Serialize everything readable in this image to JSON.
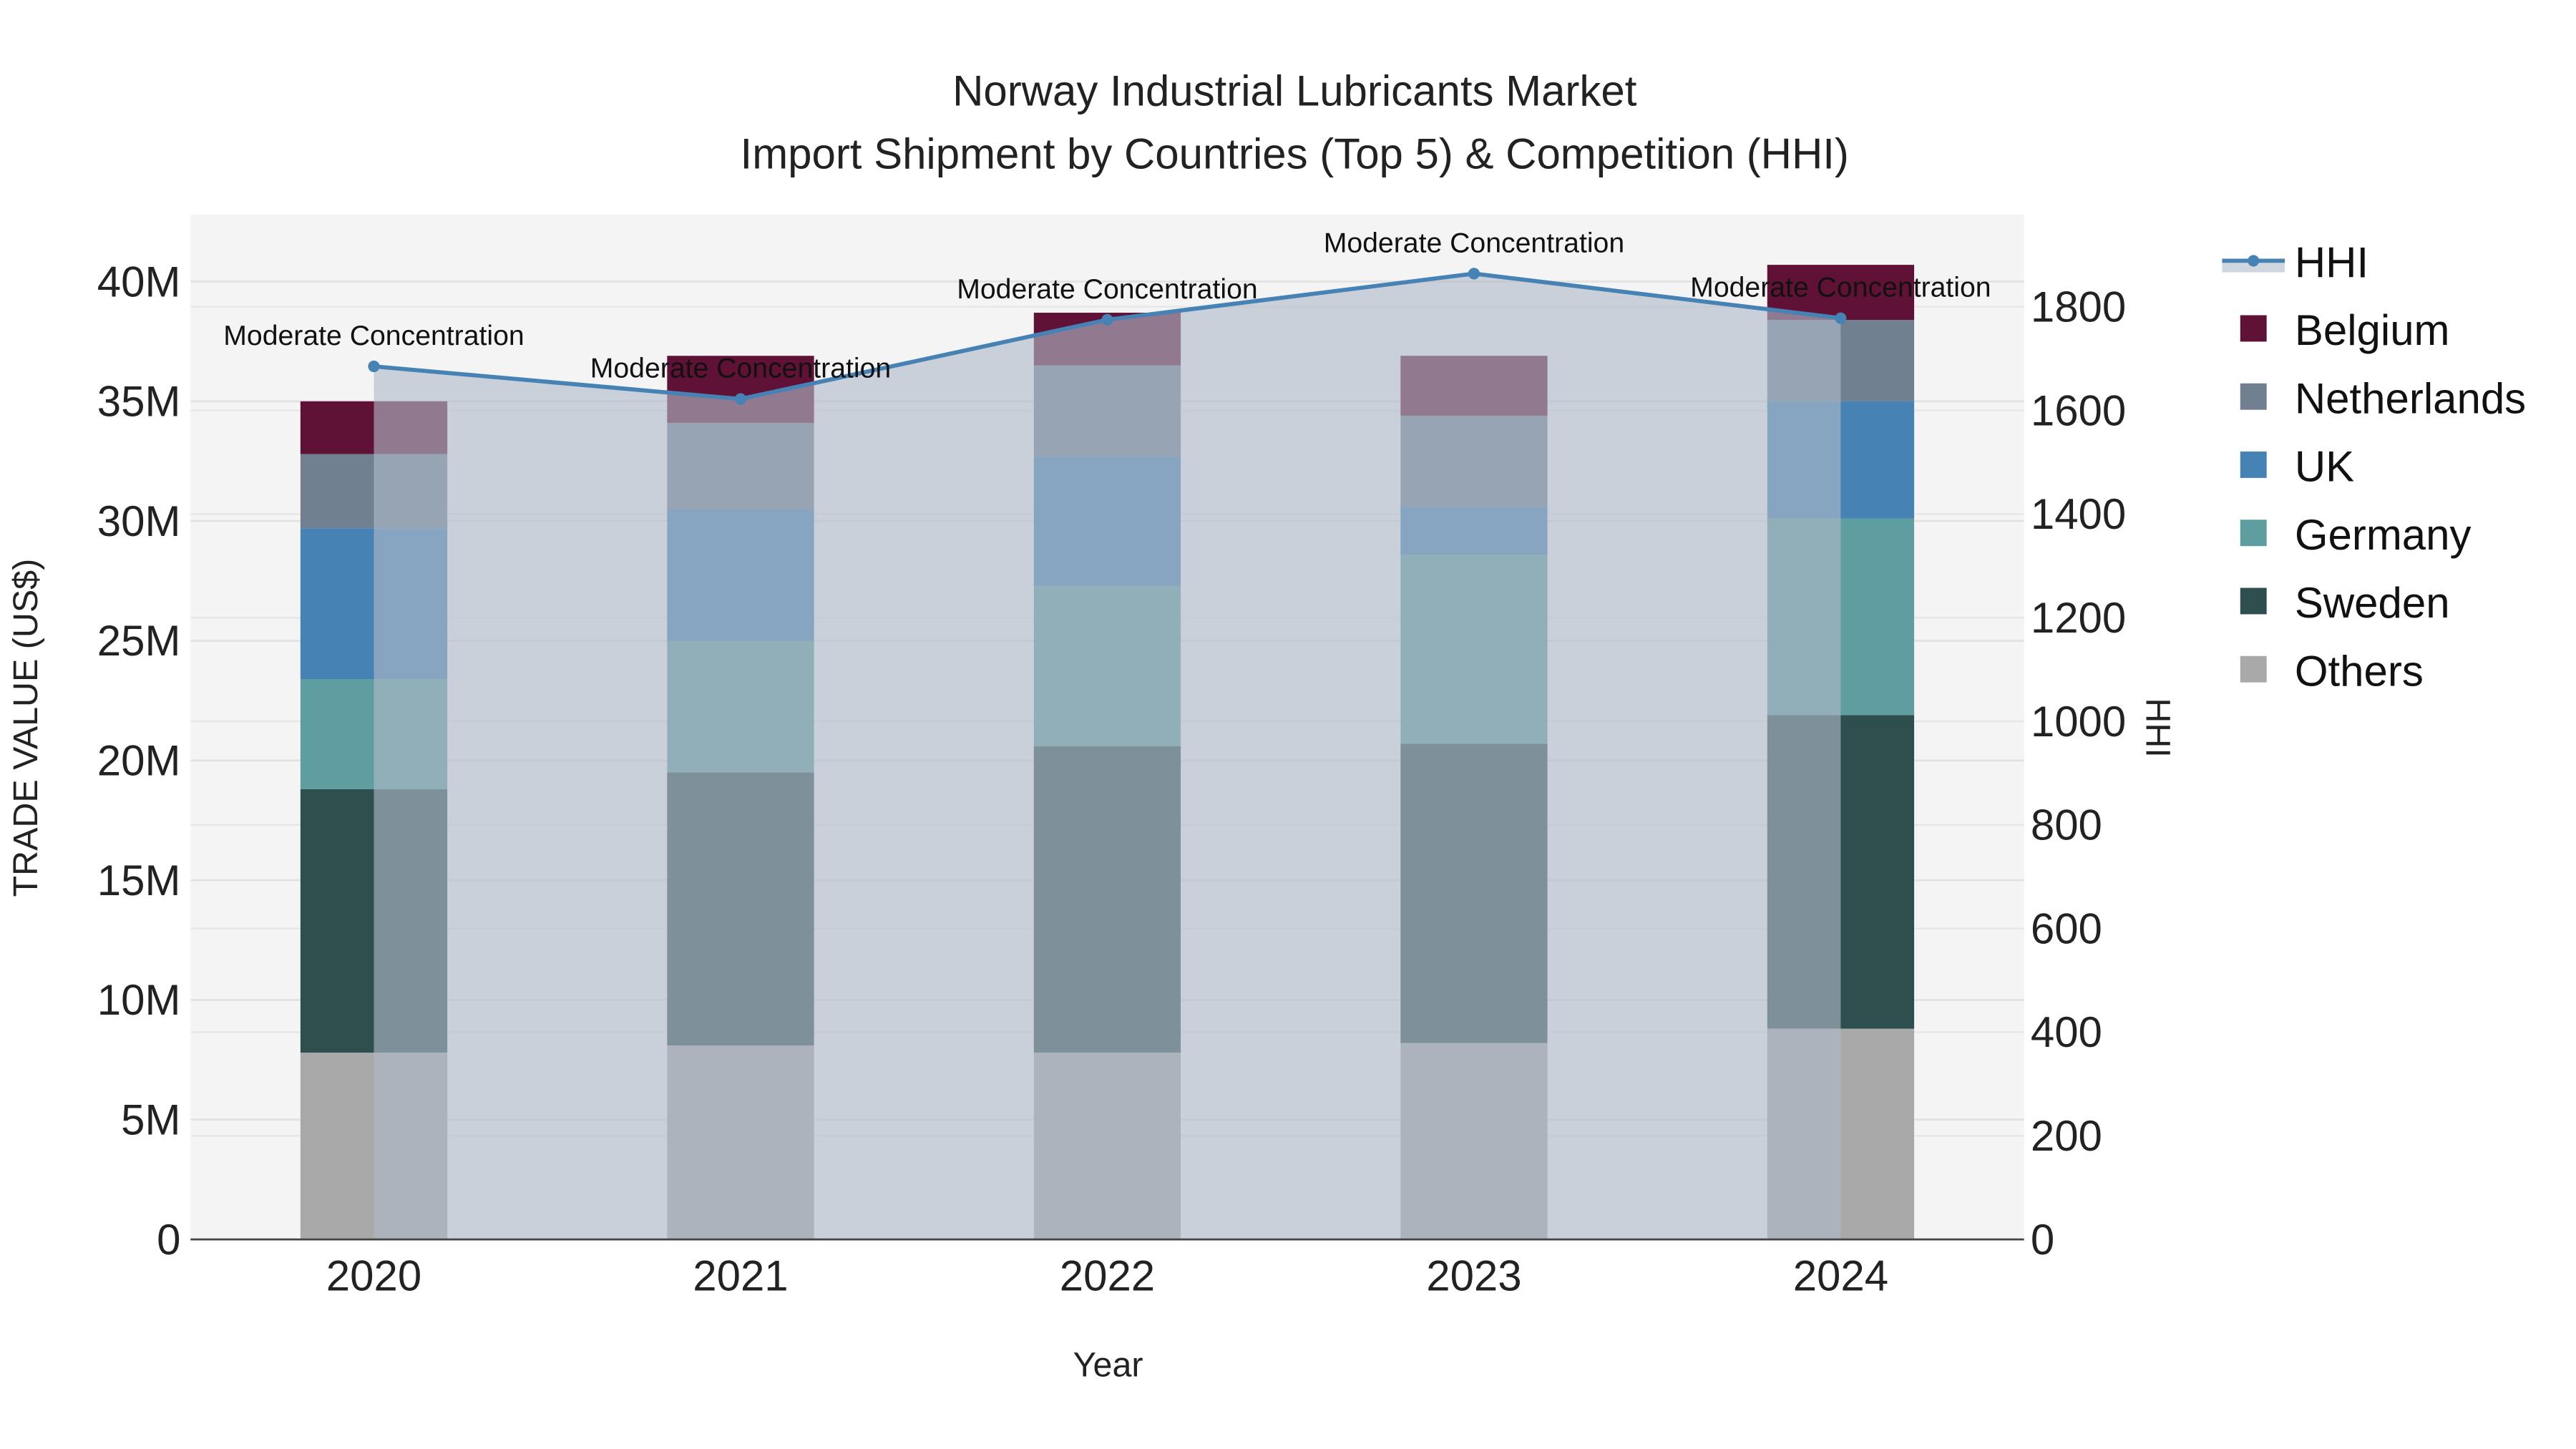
{
  "chart_data": {
    "type": "bar",
    "title": "Norway Industrial Lubricants Market",
    "subtitle": "Import Shipment by Countries (Top 5) & Competition (HHI)",
    "xlabel": "Year",
    "ylabel": "TRADE VALUE (US$)",
    "y2label": "HHI",
    "categories": [
      "2020",
      "2021",
      "2022",
      "2023",
      "2024"
    ],
    "ylim": [
      0,
      42.8
    ],
    "y2lim": [
      0,
      1978
    ],
    "yticks": [
      {
        "v": 0,
        "label": "0"
      },
      {
        "v": 5,
        "label": "5M"
      },
      {
        "v": 10,
        "label": "10M"
      },
      {
        "v": 15,
        "label": "15M"
      },
      {
        "v": 20,
        "label": "20M"
      },
      {
        "v": 25,
        "label": "25M"
      },
      {
        "v": 30,
        "label": "30M"
      },
      {
        "v": 35,
        "label": "35M"
      },
      {
        "v": 40,
        "label": "40M"
      }
    ],
    "y2ticks": [
      {
        "v": 0,
        "label": "0"
      },
      {
        "v": 200,
        "label": "200"
      },
      {
        "v": 400,
        "label": "400"
      },
      {
        "v": 600,
        "label": "600"
      },
      {
        "v": 800,
        "label": "800"
      },
      {
        "v": 1000,
        "label": "1000"
      },
      {
        "v": 1200,
        "label": "1200"
      },
      {
        "v": 1400,
        "label": "1400"
      },
      {
        "v": 1600,
        "label": "1600"
      },
      {
        "v": 1800,
        "label": "1800"
      }
    ],
    "units": "million US$",
    "series": [
      {
        "name": "Others",
        "color": "#a9a9a9",
        "values": [
          7.8,
          8.1,
          7.8,
          8.2,
          8.8
        ]
      },
      {
        "name": "Sweden",
        "color": "#2f4f4f",
        "values": [
          11.0,
          11.4,
          12.8,
          12.5,
          13.1
        ]
      },
      {
        "name": "Germany",
        "color": "#5f9ea0",
        "values": [
          4.6,
          5.5,
          6.7,
          7.9,
          8.2
        ]
      },
      {
        "name": "UK",
        "color": "#4682b4",
        "values": [
          6.3,
          5.5,
          5.4,
          2.0,
          4.9
        ]
      },
      {
        "name": "Netherlands",
        "color": "#708090",
        "values": [
          3.1,
          3.6,
          3.8,
          3.8,
          3.4
        ]
      },
      {
        "name": "Belgium",
        "color": "#5f1235",
        "values": [
          2.2,
          2.8,
          2.2,
          2.5,
          2.3
        ]
      }
    ],
    "hhi": {
      "name": "HHI",
      "color": "#4682b4",
      "values": [
        1685,
        1622,
        1775,
        1864,
        1778
      ],
      "annotations": [
        "Moderate Concentration",
        "Moderate Concentration",
        "Moderate Concentration",
        "Moderate Concentration",
        "Moderate Concentration"
      ]
    },
    "legend": [
      "HHI",
      "Belgium",
      "Netherlands",
      "UK",
      "Germany",
      "Sweden",
      "Others"
    ],
    "legend_position": "right",
    "grid": true
  }
}
